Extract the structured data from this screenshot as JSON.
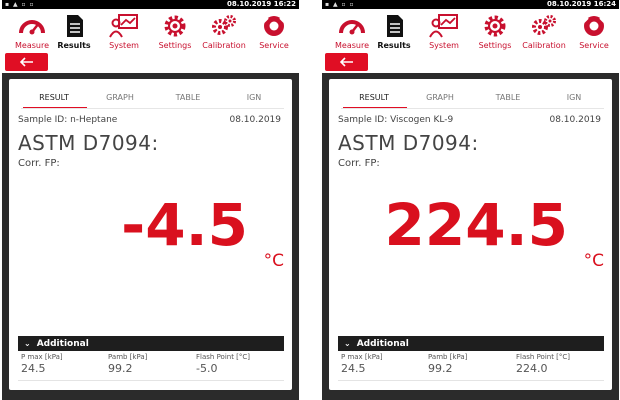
{
  "colors": {
    "accent": "#e00e24",
    "value": "#d9101e",
    "dark": "#1e1e1e"
  },
  "nav": {
    "items": [
      {
        "label": "Measure",
        "icon": "gauge-icon"
      },
      {
        "label": "Results",
        "icon": "document-icon"
      },
      {
        "label": "System",
        "icon": "person-chart-icon"
      },
      {
        "label": "Settings",
        "icon": "gear-icon"
      },
      {
        "label": "Calibration",
        "icon": "calibration-gears-icon"
      },
      {
        "label": "Service",
        "icon": "service-icon"
      }
    ],
    "back_icon": "arrow-left-icon"
  },
  "tabs": [
    "RESULT",
    "GRAPH",
    "TABLE",
    "IGN"
  ],
  "additional_label": "Additional",
  "additional_headers": [
    "P max [kPa]",
    "Pamb [kPa]",
    "Flash Point [°C]"
  ],
  "panels": [
    {
      "time": "08.10.2019 16:22",
      "sample_id": "Sample ID: n-Heptane",
      "date": "08.10.2019",
      "method": "ASTM D7094:",
      "corr_label": "Corr. FP:",
      "value": "-4.5",
      "unit": "°C",
      "additional_values": [
        "24.5",
        "99.2",
        "-5.0"
      ]
    },
    {
      "time": "08.10.2019 16:24",
      "sample_id": "Sample ID: Viscogen KL-9",
      "date": "08.10.2019",
      "method": "ASTM D7094:",
      "corr_label": "Corr. FP:",
      "value": "224.5",
      "unit": "°C",
      "additional_values": [
        "24.5",
        "99.2",
        "224.0"
      ]
    }
  ]
}
